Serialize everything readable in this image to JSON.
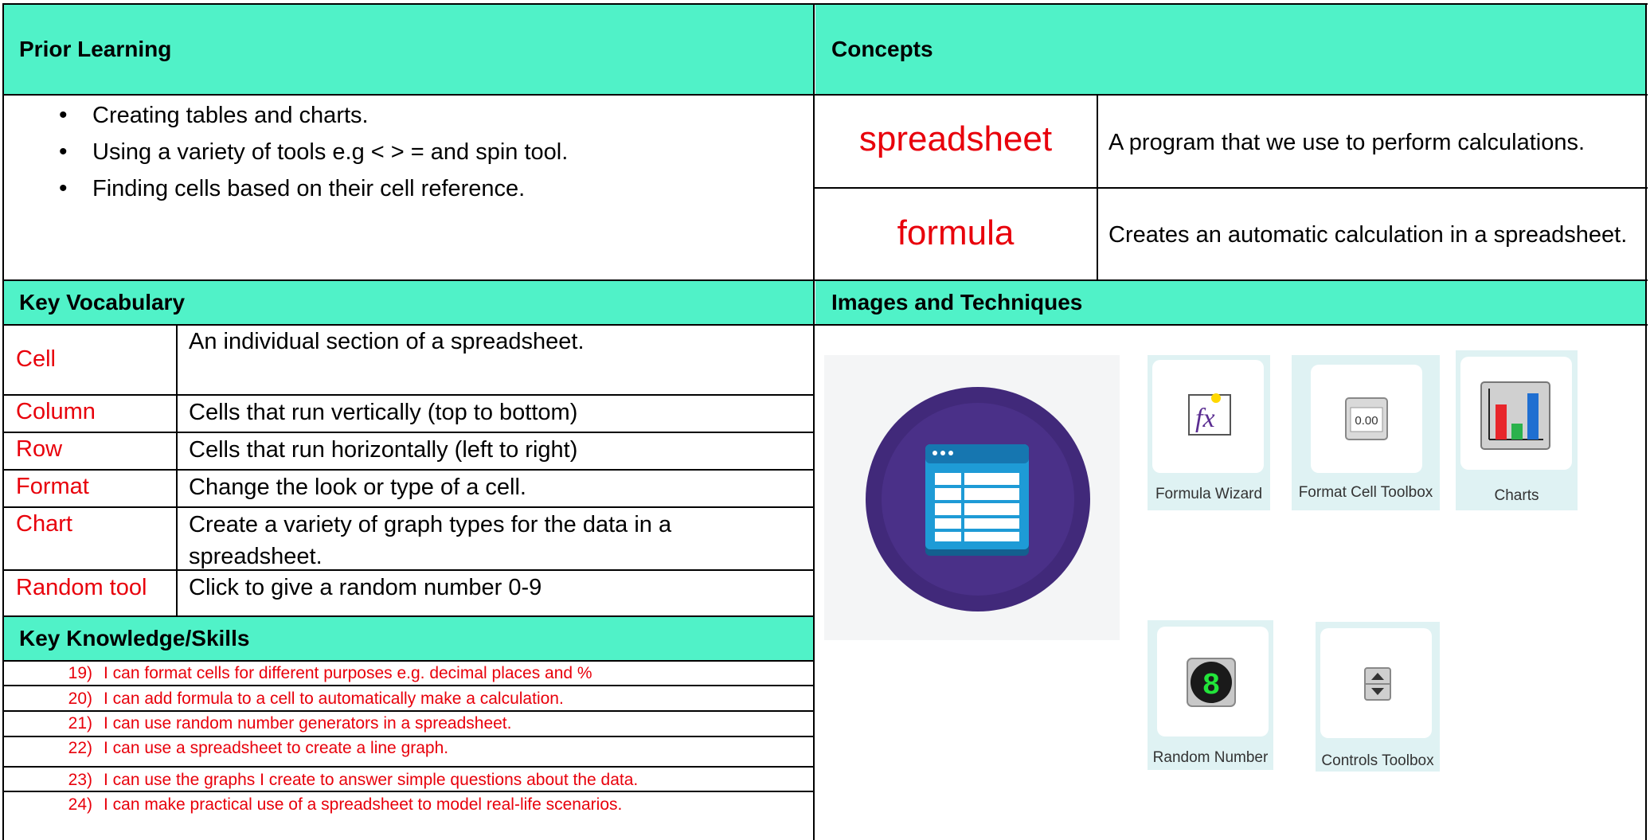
{
  "prior_learning": {
    "heading": "Prior Learning",
    "items": [
      "Creating tables and charts.",
      "Using a variety of tools e.g < > = and spin tool.",
      "Finding cells based on their cell reference."
    ]
  },
  "concepts": {
    "heading": "Concepts",
    "rows": [
      {
        "term": "spreadsheet",
        "definition": "A program that we use to perform calculations."
      },
      {
        "term": "formula",
        "definition": "Creates an automatic calculation in a spreadsheet."
      }
    ]
  },
  "key_vocabulary": {
    "heading": "Key Vocabulary",
    "rows": [
      {
        "term": "Cell",
        "definition": "An individual section of a spreadsheet."
      },
      {
        "term": "Column",
        "definition": "Cells that run vertically (top to bottom)"
      },
      {
        "term": "Row",
        "definition": "Cells that run horizontally (left to right)"
      },
      {
        "term": "Format",
        "definition": "Change the look or type of a cell."
      },
      {
        "term": "Chart",
        "definition": "Create a variety of graph types for the data in a spreadsheet."
      },
      {
        "term": "Random tool",
        "definition": "Click to give a random number 0-9"
      }
    ]
  },
  "key_knowledge": {
    "heading": "Key Knowledge/Skills",
    "items": [
      {
        "num": "19)",
        "text": "I can format cells for different purposes e.g. decimal places and %"
      },
      {
        "num": "20)",
        "text": "I can add formula to a cell to automatically make a calculation."
      },
      {
        "num": "21)",
        "text": "I can use random number generators in a spreadsheet."
      },
      {
        "num": "22)",
        "text": "I can use a spreadsheet to create a line graph."
      },
      {
        "num": "23)",
        "text": "I can use the graphs I create to answer simple questions about the data."
      },
      {
        "num": "24)",
        "text": "I can make practical use of a spreadsheet to model real-life scenarios."
      }
    ]
  },
  "images_techniques": {
    "heading": "Images and Techniques",
    "tiles": {
      "formula_wizard": "Formula Wizard",
      "format_cell_toolbox": "Format Cell Toolbox",
      "charts": "Charts",
      "random_number": "Random Number",
      "controls_toolbox": "Controls Toolbox"
    },
    "format_cell_value": "0.00",
    "fx_text": "fx",
    "digit_display": "8"
  },
  "colors": {
    "header_bg": "#50f2c8",
    "term_red": "#e8000b",
    "icon_purple": "#4a2f85",
    "icon_blue": "#1e9bd6"
  }
}
